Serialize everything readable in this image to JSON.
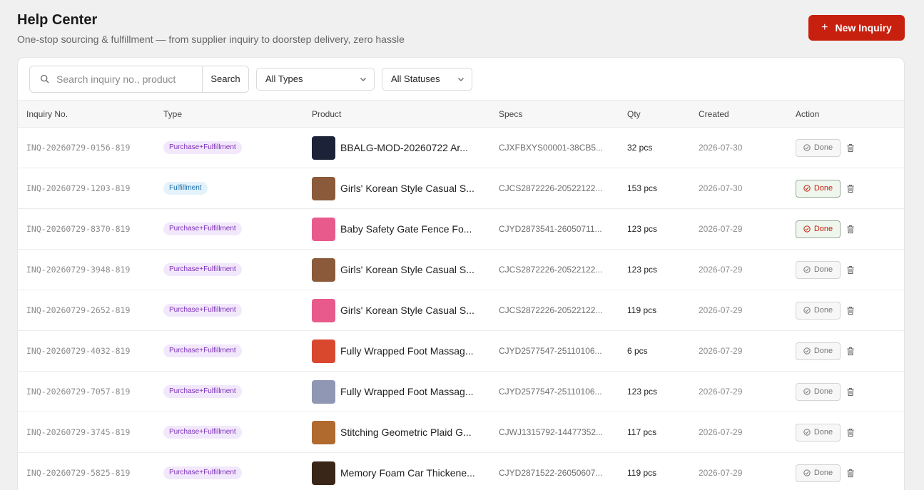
{
  "header": {
    "title": "Help Center",
    "subtitle": "One-stop sourcing & fulfillment — from supplier inquiry to doorstep delivery, zero hassle",
    "new_button": "New Inquiry",
    "new_icon": "+"
  },
  "toolbar": {
    "search_placeholder": "Search inquiry no., product",
    "search_button": "Search",
    "type_filter": "All Types",
    "status_filter": "All Statuses"
  },
  "table": {
    "columns": [
      "Inquiry No.",
      "Type",
      "Product",
      "Specs",
      "Qty",
      "Created",
      "Action"
    ],
    "rows": [
      {
        "inquiry": "INQ-20260729-0156-819",
        "type": "Purchase+Fulfillment",
        "type_kind": "pf",
        "product": "BBALG-MOD-20260722 Ar...",
        "thumb": "#1c2238",
        "specs": "CJXFBXYS00001-38CB5...",
        "qty": "32 pcs",
        "created": "2026-07-30",
        "action": "Done",
        "highlight": false
      },
      {
        "inquiry": "INQ-20260729-1203-819",
        "type": "Fulfillment",
        "type_kind": "f",
        "product": "Girls' Korean Style Casual S...",
        "thumb": "#8a5a3a",
        "specs": "CJCS2872226-20522122...",
        "qty": "153 pcs",
        "created": "2026-07-30",
        "action": "Done",
        "highlight": true
      },
      {
        "inquiry": "INQ-20260729-8370-819",
        "type": "Purchase+Fulfillment",
        "type_kind": "pf",
        "product": "Baby Safety Gate Fence Fo...",
        "thumb": "#e85a8c",
        "specs": "CJYD2873541-26050711...",
        "qty": "123 pcs",
        "created": "2026-07-29",
        "action": "Done",
        "highlight": true
      },
      {
        "inquiry": "INQ-20260729-3948-819",
        "type": "Purchase+Fulfillment",
        "type_kind": "pf",
        "product": "Girls' Korean Style Casual S...",
        "thumb": "#8a5a3a",
        "specs": "CJCS2872226-20522122...",
        "qty": "123 pcs",
        "created": "2026-07-29",
        "action": "Done",
        "highlight": false
      },
      {
        "inquiry": "INQ-20260729-2652-819",
        "type": "Purchase+Fulfillment",
        "type_kind": "pf",
        "product": "Girls' Korean Style Casual S...",
        "thumb": "#e85a8c",
        "specs": "CJCS2872226-20522122...",
        "qty": "119 pcs",
        "created": "2026-07-29",
        "action": "Done",
        "highlight": false
      },
      {
        "inquiry": "INQ-20260729-4032-819",
        "type": "Purchase+Fulfillment",
        "type_kind": "pf",
        "product": "Fully Wrapped Foot Massag...",
        "thumb": "#d9482e",
        "specs": "CJYD2577547-25110106...",
        "qty": "6 pcs",
        "created": "2026-07-29",
        "action": "Done",
        "highlight": false
      },
      {
        "inquiry": "INQ-20260729-7057-819",
        "type": "Purchase+Fulfillment",
        "type_kind": "pf",
        "product": "Fully Wrapped Foot Massag...",
        "thumb": "#8f97b5",
        "specs": "CJYD2577547-25110106...",
        "qty": "123 pcs",
        "created": "2026-07-29",
        "action": "Done",
        "highlight": false
      },
      {
        "inquiry": "INQ-20260729-3745-819",
        "type": "Purchase+Fulfillment",
        "type_kind": "pf",
        "product": "Stitching Geometric Plaid G...",
        "thumb": "#b06a2e",
        "specs": "CJWJ1315792-14477352...",
        "qty": "117 pcs",
        "created": "2026-07-29",
        "action": "Done",
        "highlight": false
      },
      {
        "inquiry": "INQ-20260729-5825-819",
        "type": "Purchase+Fulfillment",
        "type_kind": "pf",
        "product": "Memory Foam Car Thickene...",
        "thumb": "#3a2618",
        "specs": "CJYD2871522-26050607...",
        "qty": "119 pcs",
        "created": "2026-07-29",
        "action": "Done",
        "highlight": false
      }
    ]
  },
  "colors": {
    "accent": "#c8200e",
    "purple_badge": "#7b2fb8",
    "blue_badge": "#1b6fa8"
  }
}
